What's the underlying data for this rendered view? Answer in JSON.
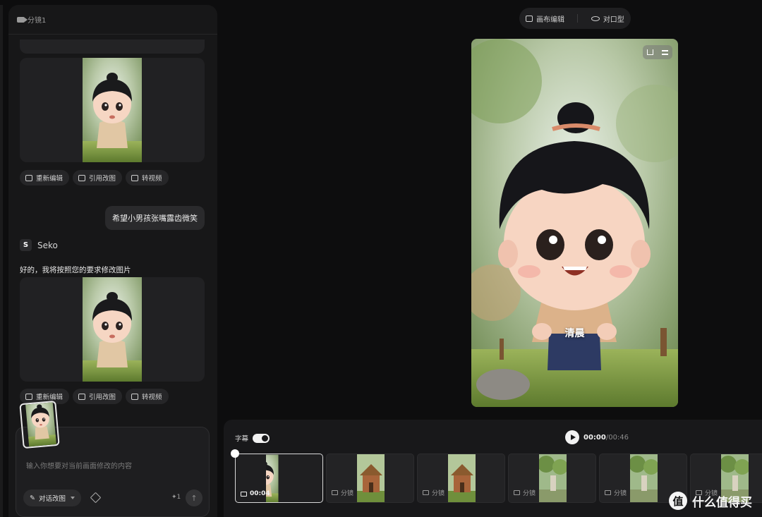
{
  "chat_panel": {
    "header_title": "分镜1",
    "actions": [
      "重新编辑",
      "引用改图",
      "转视频"
    ],
    "user_message": "希望小男孩张嘴露齿微笑",
    "assistant_name": "Seko",
    "assistant_reply": "好的，我将按照您的要求修改图片",
    "input_placeholder": "输入你想要对当前画面修改的内容",
    "mode_label": "对话改图",
    "credit_count": "1",
    "credit_icon": "sparkle-icon"
  },
  "toolbar": {
    "canvas_edit": "画布编辑",
    "lip_sync": "对口型"
  },
  "preview": {
    "subtitle": "清晨"
  },
  "timeline": {
    "subtitle_label": "字幕",
    "subtitle_enabled": true,
    "time_current": "00:00",
    "time_total": "/00:46",
    "clips": [
      {
        "label": "00:04"
      },
      {
        "label": "分镜"
      },
      {
        "label": "分镜"
      },
      {
        "label": "分镜"
      },
      {
        "label": "分镜"
      },
      {
        "label": "分镜"
      }
    ]
  },
  "watermark": {
    "logo": "值",
    "text": "什么值得买"
  }
}
